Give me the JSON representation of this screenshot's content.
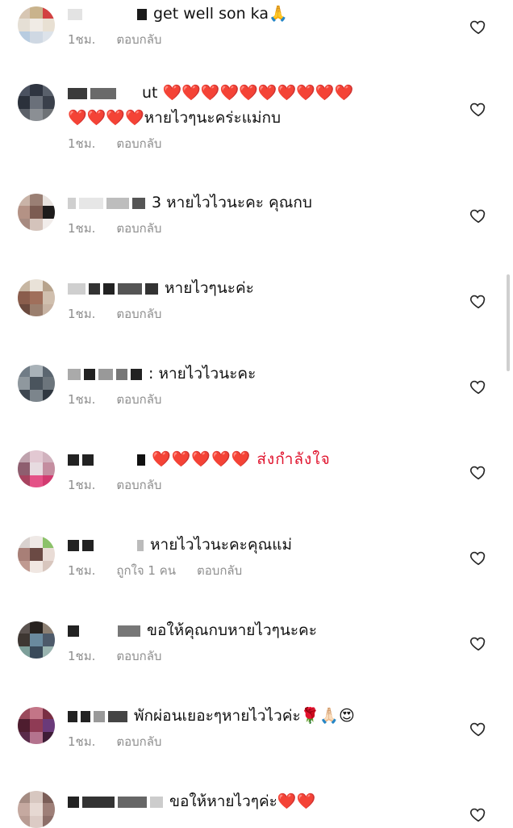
{
  "comments": [
    {
      "text": "get well son ka🙏",
      "time": "1ชม.",
      "reply": "ตอบกลับ",
      "likes": ""
    },
    {
      "text_line1": "ut ❤️❤️❤️❤️❤️❤️❤️❤️❤️❤️",
      "text_line2": "❤️❤️❤️❤️หายไวๆนะคร่ะแม่กบ",
      "time": "1ชม.",
      "reply": "ตอบกลับ",
      "likes": ""
    },
    {
      "text": "3 หายไวไวนะคะ คุณกบ",
      "time": "1ชม.",
      "reply": "ตอบกลับ",
      "likes": ""
    },
    {
      "text": "หายไวๆนะค่ะ",
      "time": "1ชม.",
      "reply": "ตอบกลับ",
      "likes": ""
    },
    {
      "text": ": หายไวไวนะคะ",
      "time": "1ชม.",
      "reply": "ตอบกลับ",
      "likes": ""
    },
    {
      "text": "❤️❤️❤️❤️❤️ ส่งกำลังใจ",
      "time": "1ชม.",
      "reply": "ตอบกลับ",
      "likes": ""
    },
    {
      "text": "หายไวไวนะคะคุณแม่",
      "time": "1ชม.",
      "reply": "ตอบกลับ",
      "likes": "ถูกใจ 1 คน"
    },
    {
      "text": "ขอให้คุณกบหายไวๆนะคะ",
      "time": "1ชม.",
      "reply": "ตอบกลับ",
      "likes": ""
    },
    {
      "text": "พักผ่อนเยอะๆหายไวไวค่ะ🌹🙏🏻😍",
      "time": "1ชม.",
      "reply": "ตอบกลับ",
      "likes": ""
    },
    {
      "text": "ขอให้หายไวๆค่ะ❤️❤️",
      "time": "",
      "reply": "",
      "likes": ""
    }
  ],
  "icons": {
    "like": "heart-outline-icon",
    "avatar": "user-avatar-blurred"
  },
  "colors": {
    "meta": "#8e8e8e",
    "heart": "#e0132d"
  }
}
